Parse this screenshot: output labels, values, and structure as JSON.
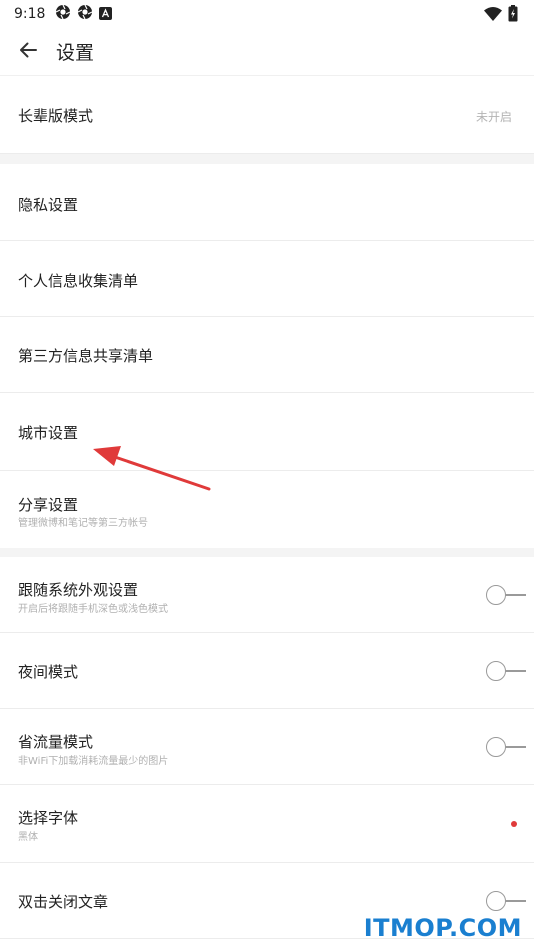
{
  "status_bar": {
    "time": "9:18",
    "left_icons": [
      "camera-shutter-icon",
      "camera-shutter-icon",
      "notification-a-icon"
    ],
    "right_icons": [
      "wifi-icon",
      "battery-charging-icon"
    ]
  },
  "app_bar": {
    "back_icon": "arrow-left-icon",
    "title": "设置"
  },
  "settings": {
    "elder_mode": {
      "label": "长辈版模式",
      "value": "未开启"
    },
    "privacy": {
      "label": "隐私设置"
    },
    "personal_info": {
      "label": "个人信息收集清单"
    },
    "third_party": {
      "label": "第三方信息共享清单"
    },
    "city": {
      "label": "城市设置"
    },
    "share": {
      "label": "分享设置",
      "sub": "管理微博和笔记等第三方帐号"
    },
    "follow_system": {
      "label": "跟随系统外观设置",
      "sub": "开启后将跟随手机深色或浅色模式",
      "enabled": false
    },
    "night_mode": {
      "label": "夜间模式",
      "enabled": false
    },
    "data_saver": {
      "label": "省流量模式",
      "sub": "非WiFi下加载消耗流量最少的图片",
      "enabled": false
    },
    "font": {
      "label": "选择字体",
      "sub": "黑体",
      "indicator": "red-dot"
    },
    "double_tap_close": {
      "label": "双击关闭文章",
      "enabled": false
    }
  },
  "annotation": {
    "type": "red-arrow",
    "target": "城市设置"
  },
  "watermark": {
    "text": "ITMOP.COM"
  },
  "colors": {
    "accent_red": "#e03a3a",
    "watermark_blue": "#1a7fd0",
    "text_primary": "#222222",
    "text_secondary": "#b0b0b0",
    "section_gap": "#f4f4f4"
  }
}
